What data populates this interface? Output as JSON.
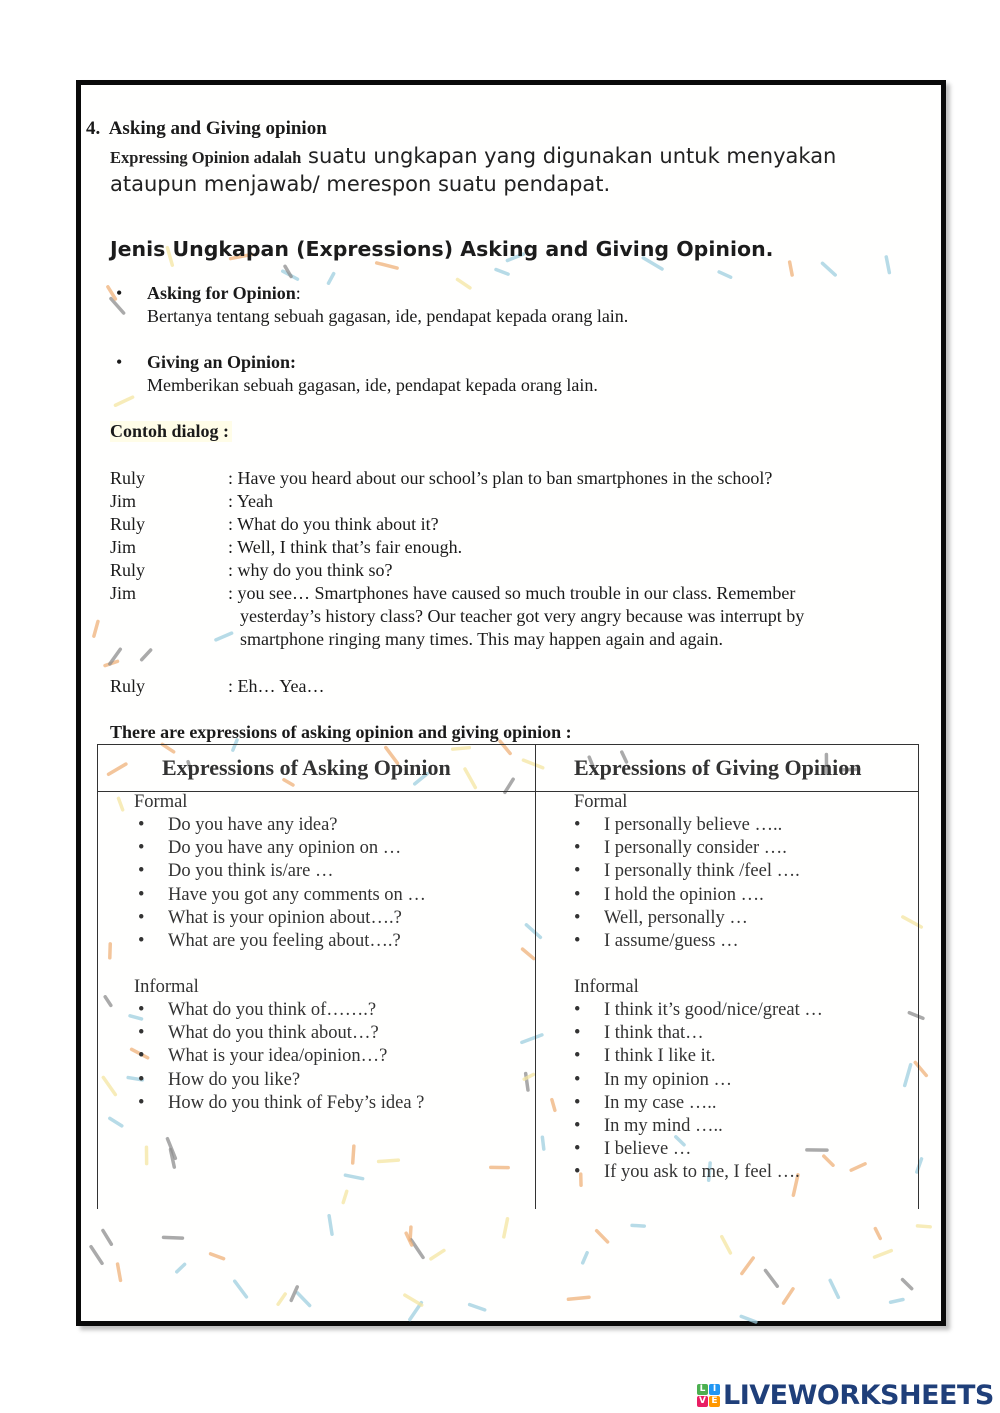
{
  "section": {
    "number": "4.",
    "title": "Asking and Giving opinion",
    "intro_lead": "Expressing Opinion adalah",
    "intro_line1": "suatu ungkapan yang digunakan untuk menyakan",
    "intro_line2": "ataupun menjawab/ merespon suatu pendapat."
  },
  "jenis_heading": "Jenis Ungkapan (Expressions) Asking and Giving Opinion.",
  "definitions": [
    {
      "bullet": "•",
      "title": "Asking for Opinion",
      "title_suffix": ":",
      "desc": "Bertanya tentang sebuah gagasan, ide, pendapat kepada orang lain."
    },
    {
      "bullet": "•",
      "title": "Giving an Opinion:",
      "title_suffix": "",
      "desc": "Memberikan sebuah gagasan, ide, pendapat kepada orang lain."
    }
  ],
  "dialog": {
    "heading": "Contoh dialog :",
    "lines": [
      {
        "speaker": "Ruly",
        "text": ": Have you heard about our school’s plan to ban smartphones in the school?"
      },
      {
        "speaker": "Jim",
        "text": ": Yeah"
      },
      {
        "speaker": "Ruly",
        "text": ": What do you think about it?"
      },
      {
        "speaker": "Jim",
        "text": ": Well, I think that’s fair enough."
      },
      {
        "speaker": "Ruly",
        "text": ": why do you think so?"
      },
      {
        "speaker": "Jim",
        "text": ": you see… Smartphones have caused so much trouble in our class. Remember",
        "cont1": "yesterday’s history class? Our teacher got very angry because was interrupt by",
        "cont2": "smartphone ringing many times. This may happen again and again."
      },
      {
        "speaker": "Ruly",
        "text": ": Eh… Yea…"
      }
    ]
  },
  "expressions_intro": "There are expressions of asking opinion and giving opinion :",
  "table": {
    "asking": {
      "header": "Expressions of Asking Opinion",
      "formal_label": "Formal",
      "formal": [
        "Do you have any idea?",
        "Do you have any opinion on …",
        "Do you think is/are …",
        "Have you got any comments on …",
        "What is your opinion about….?",
        "What are you feeling about….?"
      ],
      "informal_label": "Informal",
      "informal": [
        "What do you think of…….?",
        "What do you think about…?",
        "What is your idea/opinion…?",
        "How do you like?",
        "How do you think of Feby’s idea ?"
      ]
    },
    "giving": {
      "header": "Expressions of Giving Opinion",
      "formal_label": "Formal",
      "formal": [
        "I personally believe …..",
        "I personally consider ….",
        "I personally think /feel ….",
        "I hold the opinion ….",
        "Well, personally …",
        "I assume/guess …"
      ],
      "informal_label": "Informal",
      "informal": [
        "I think it’s good/nice/great …",
        "I think that…",
        "I think I like it.",
        "In my opinion …",
        "In my case …..",
        "In my mind …..",
        "I believe …",
        "If you ask to me, I feel …."
      ]
    }
  },
  "bullet_glyph": "•",
  "branding": {
    "logo_letters": [
      "L",
      "I",
      "V",
      "E"
    ],
    "logo_colors": [
      "#4caf50",
      "#2196f3",
      "#e91e63",
      "#ff9800"
    ],
    "logo_text": "LIVEWORKSHEETS",
    "text_color": "#1f3f7a"
  },
  "sprinkle_colors": [
    "#f0b27a",
    "#9fd0e0",
    "#f5e6a3",
    "#8e8e8e"
  ]
}
